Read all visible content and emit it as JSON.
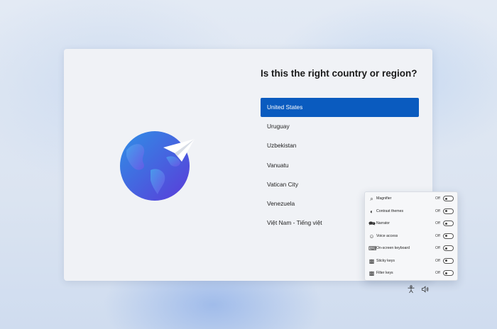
{
  "page": {
    "title": "Is this the right country or region?"
  },
  "countries": {
    "selected_index": 0,
    "items": [
      "United States",
      "Uruguay",
      "Uzbekistan",
      "Vanuatu",
      "Vatican City",
      "Venezuela",
      "Việt Nam - Tiếng việt"
    ]
  },
  "accessibility_panel": {
    "rows": [
      {
        "label": "Magnifier",
        "state": "Off",
        "icon": "magnifier-icon"
      },
      {
        "label": "Contrast themes",
        "state": "Off",
        "icon": "contrast-icon"
      },
      {
        "label": "Narrator",
        "state": "Off",
        "icon": "narrator-icon"
      },
      {
        "label": "Voice access",
        "state": "Off",
        "icon": "voice-access-icon"
      },
      {
        "label": "On-screen keyboard",
        "state": "Off",
        "icon": "keyboard-icon"
      },
      {
        "label": "Sticky keys",
        "state": "Off",
        "icon": "sticky-keys-icon"
      },
      {
        "label": "Filter keys",
        "state": "Off",
        "icon": "filter-keys-icon"
      }
    ]
  },
  "taskbar": {
    "icons": [
      "accessibility-icon",
      "volume-icon"
    ]
  },
  "colors": {
    "accent": "#0a5bbf",
    "globe_light": "#3b8ee0",
    "globe_dark": "#5a3fd8"
  }
}
